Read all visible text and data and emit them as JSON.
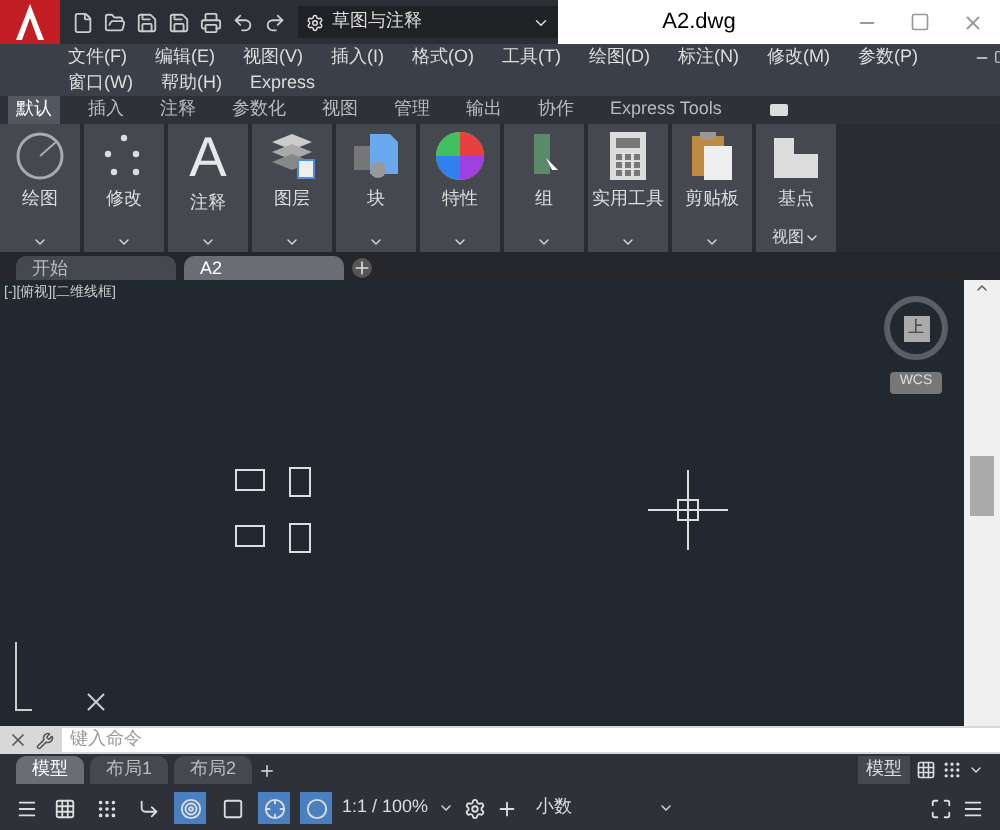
{
  "window": {
    "title": "A2.dwg",
    "workspace": "草图与注释"
  },
  "menu_rows": [
    [
      "文件(F)",
      "编辑(E)",
      "视图(V)",
      "插入(I)",
      "格式(O)",
      "工具(T)",
      "绘图(D)",
      "标注(N)",
      "修改(M)",
      "参数(P)"
    ],
    [
      "窗口(W)",
      "帮助(H)",
      "Express"
    ]
  ],
  "ribbon_tabs": [
    {
      "label": "默认",
      "selected": true
    },
    {
      "label": "插入",
      "selected": false
    },
    {
      "label": "注释",
      "selected": false
    },
    {
      "label": "参数化",
      "selected": false
    },
    {
      "label": "视图",
      "selected": false
    },
    {
      "label": "管理",
      "selected": false
    },
    {
      "label": "输出",
      "selected": false
    },
    {
      "label": "协作",
      "selected": false
    },
    {
      "label": "Express Tools",
      "selected": false
    }
  ],
  "ribbon_panels": [
    {
      "kind": "draw",
      "label": "绘图"
    },
    {
      "kind": "modify",
      "label": "修改"
    },
    {
      "kind": "annotate",
      "label": "注释",
      "glyph": "A"
    },
    {
      "kind": "layers",
      "label": "图层"
    },
    {
      "kind": "block",
      "label": "块"
    },
    {
      "kind": "properties",
      "label": "特性"
    },
    {
      "kind": "group",
      "label": "组"
    },
    {
      "kind": "utilities",
      "label": "实用工具"
    },
    {
      "kind": "clipboard",
      "label": "剪贴板"
    },
    {
      "kind": "basepoint",
      "label": "基点",
      "footer": "视图"
    }
  ],
  "doc_tabs": [
    {
      "label": "开始",
      "selected": false
    },
    {
      "label": "A2",
      "selected": true
    }
  ],
  "viewport": {
    "label": "[-][俯视][二维线框]",
    "viewcube": "上",
    "ucs": "WCS"
  },
  "command_line": {
    "placeholder": "键入命令"
  },
  "layout_tabs": [
    {
      "label": "模型",
      "selected": true
    },
    {
      "label": "布局1",
      "selected": false
    },
    {
      "label": "布局2",
      "selected": false
    }
  ],
  "status_bar": {
    "space": "模型",
    "scale": "1:1 / 100%",
    "units": "小数",
    "toggles": [
      {
        "kind": "grid",
        "on": false
      },
      {
        "kind": "snap",
        "on": false
      },
      {
        "kind": "ortho",
        "on": false
      },
      {
        "kind": "polar",
        "on": true
      },
      {
        "kind": "osnap",
        "on": false
      },
      {
        "kind": "object",
        "on": true
      },
      {
        "kind": "annot",
        "on": true
      }
    ]
  }
}
